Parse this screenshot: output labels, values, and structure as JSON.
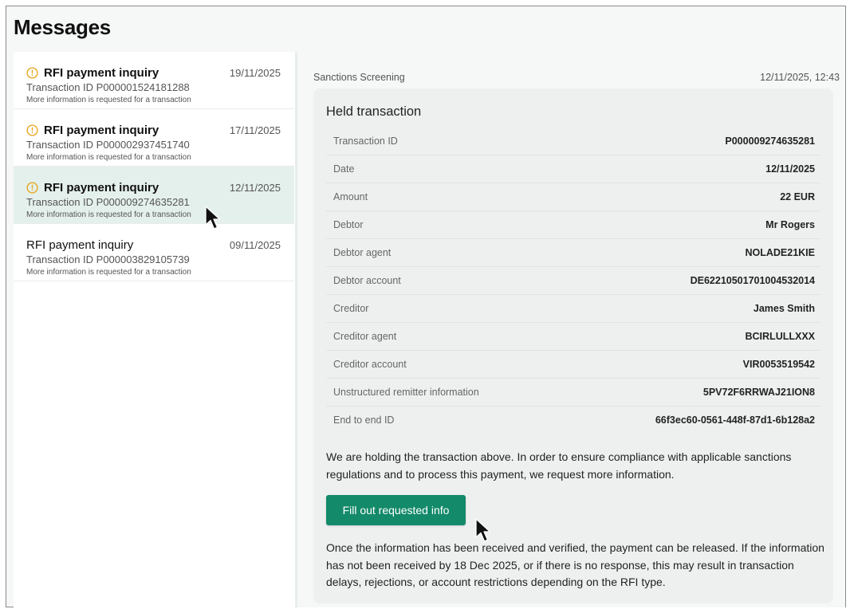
{
  "page": {
    "title": "Messages"
  },
  "messages": [
    {
      "title": "RFI payment inquiry",
      "date": "19/11/2025",
      "transaction_id": "Transaction ID P000001524181288",
      "description": "More information is requested for a transaction",
      "icon": "warning-circle-icon",
      "unread": true
    },
    {
      "title": "RFI payment inquiry",
      "date": "17/11/2025",
      "transaction_id": "Transaction ID P000002937451740",
      "description": "More information is requested for a transaction",
      "icon": "warning-circle-icon",
      "unread": true
    },
    {
      "title": "RFI payment inquiry",
      "date": "12/11/2025",
      "transaction_id": "Transaction ID P000009274635281",
      "description": "More information is requested for a transaction",
      "icon": "warning-circle-icon",
      "unread": true,
      "selected": true
    },
    {
      "title": "RFI payment inquiry",
      "date": "09/11/2025",
      "transaction_id": "Transaction ID P000003829105739",
      "description": "More information is requested for a transaction",
      "unread": false
    }
  ],
  "detail": {
    "source": "Sanctions Screening",
    "timestamp": "12/11/2025, 12:43",
    "card_title": "Held transaction",
    "fields": [
      {
        "label": "Transaction ID",
        "value": "P000009274635281"
      },
      {
        "label": "Date",
        "value": "12/11/2025"
      },
      {
        "label": "Amount",
        "value": "22 EUR"
      },
      {
        "label": "Debtor",
        "value": "Mr Rogers"
      },
      {
        "label": "Debtor agent",
        "value": "NOLADE21KIE"
      },
      {
        "label": "Debtor account",
        "value": "DE62210501701004532014"
      },
      {
        "label": "Creditor",
        "value": "James Smith"
      },
      {
        "label": "Creditor agent",
        "value": "BCIRLULLXXX"
      },
      {
        "label": "Creditor account",
        "value": "VIR0053519542"
      },
      {
        "label": "Unstructured remitter information",
        "value": "5PV72F6RRWAJ21ION8"
      },
      {
        "label": "End to end ID",
        "value": "66f3ec60-0561-448f-87d1-6b128a2"
      }
    ],
    "intro_text": "We are holding the transaction above. In order to ensure compliance with applicable sanctions regulations and to process this payment, we request more information.",
    "action_label": "Fill out requested info",
    "footer_text": "Once the information has been received and verified, the payment can be released. If the information has not been received by 18 Dec 2025, or if there is no response, this may result in transaction delays, rejections, or account restrictions depending on the RFI type."
  },
  "colors": {
    "accent": "#138a6a",
    "warning": "#e8a317",
    "selected_row": "#e4f0ec"
  }
}
